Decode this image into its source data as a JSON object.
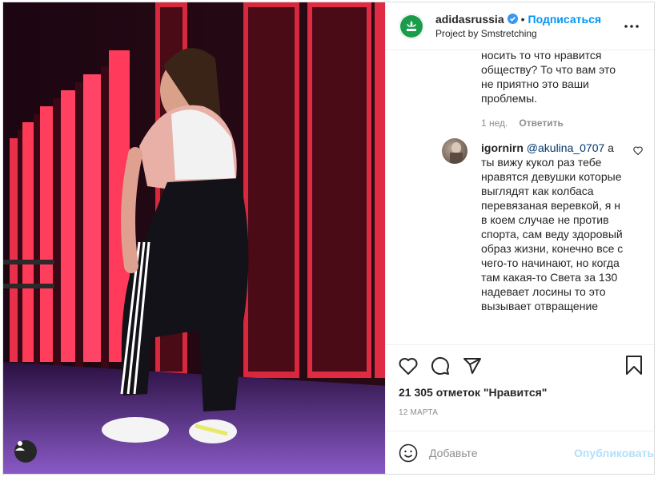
{
  "header": {
    "username": "adidasrussia",
    "separator": "•",
    "follow_label": "Подписаться",
    "subtitle": "Project by Smstretching",
    "more_icon": "more-horizontal-icon"
  },
  "comments": [
    {
      "text": "носить то что нравится обществу? То что вам это не приятно это ваши проблемы.",
      "age": "1 нед.",
      "reply_label": "Ответить"
    },
    {
      "username": "igornirn",
      "mention": "@akulina_0707",
      "text": " а ты вижу кукол раз тебе нравятся девушки которые выглядят как колбаса перевязаная веревкой, я н в коем случае не против спорта, сам веду здоровый образ жизни, конечно все с чего-то начинают, но когда там какая-то Света за 130 надевает лосины то это вызывает отвращение"
    }
  ],
  "actions": {
    "like_icon": "heart-icon",
    "comment_icon": "comment-icon",
    "share_icon": "share-icon",
    "save_icon": "bookmark-icon"
  },
  "likes": "21 305 отметок \"Нравится\"",
  "date": "12 МАРТА",
  "add_comment": {
    "placeholder": "Добавьте",
    "publish_label": "Опубликовать"
  },
  "colors": {
    "accent": "#0095f6",
    "publish_disabled": "#b2dffc",
    "brand_logo_bg": "#1a9c4a"
  }
}
